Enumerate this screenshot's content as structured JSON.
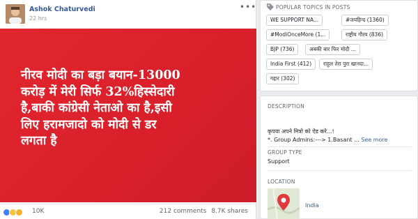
{
  "post": {
    "author": "Ashok Chaturvedi",
    "time": "22 hrs",
    "menu": "•••",
    "image_text": [
      "नीरव मोदी का बड़ा बयान-13000",
      "करोड़ में मेरी सिर्फ 32%हिस्सेदारी",
      "है,बाकी कांग्रेसी नेताओ का है,इसी",
      "लिए हरामजादो को मोदी से डर",
      "लगता है"
    ],
    "reactions_count": "10K",
    "comments": "212 comments",
    "shares": "8.7K shares"
  },
  "topics": {
    "title": "POPULAR TOPICS IN POSTS",
    "chips": [
      "WE SUPPORT NA...",
      "#जयहिन्द (1360)",
      "#ModiOnceMore (1...",
      "राष्ट्रीय गौरव (836)",
      "BJP (736)",
      "अबकी बार फिर मोदी ...",
      "India First (412)",
      "राहुल तेरा पुरा खानदा...",
      "गद्दार (302)"
    ]
  },
  "about": {
    "description_title": "DESCRIPTION",
    "description_line1": "कृपया अपने मित्रो को ऐड करे...!",
    "description_line2": "*. Group Admins:---> 1.Basant ...",
    "see_more": "See more",
    "group_type_title": "GROUP TYPE",
    "group_type": "Support",
    "location_title": "LOCATION",
    "location": "India"
  },
  "colors": {
    "post_background": "#dd2430",
    "link": "#385898"
  }
}
